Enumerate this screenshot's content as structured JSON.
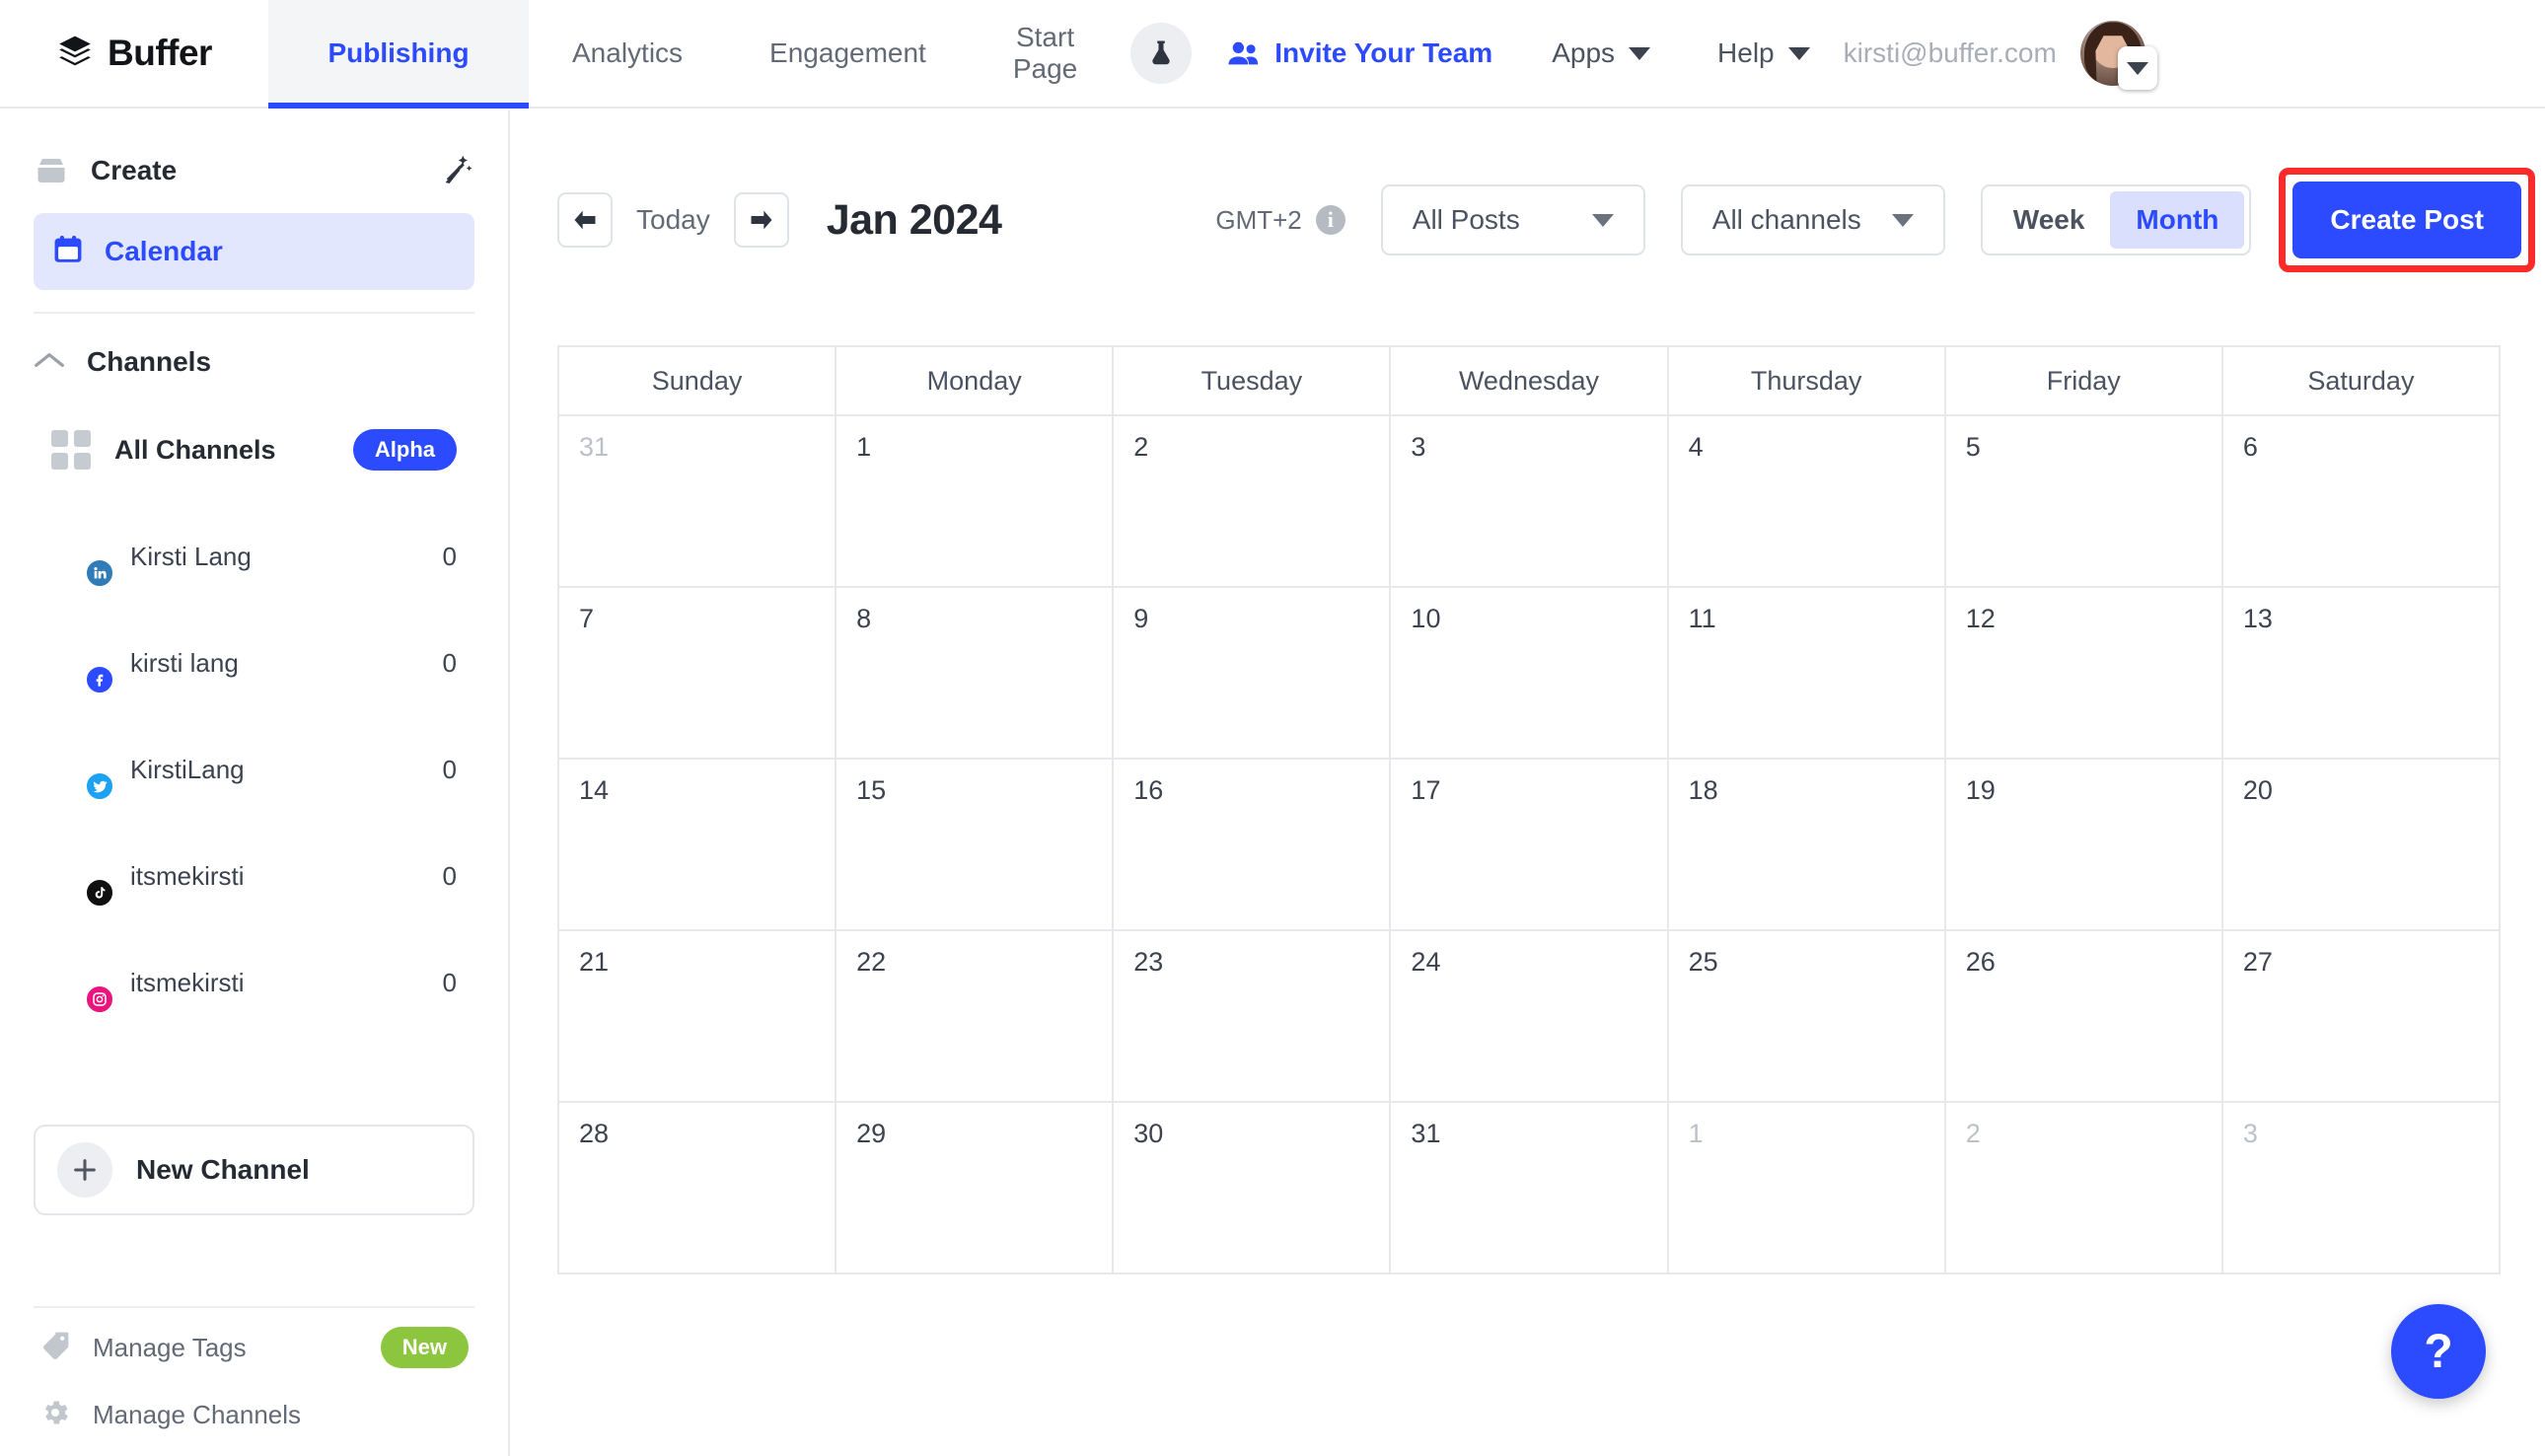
{
  "brand": {
    "name": "Buffer",
    "logo_icon": "buffer-layers-icon"
  },
  "topnav": {
    "tabs": [
      {
        "label": "Publishing",
        "active": true
      },
      {
        "label": "Analytics",
        "active": false
      },
      {
        "label": "Engagement",
        "active": false
      },
      {
        "label": "Start\nPage",
        "active": false
      }
    ],
    "lab_icon": "flask-icon",
    "invite": {
      "label": "Invite Your Team",
      "icon": "people-icon"
    },
    "apps": {
      "label": "Apps",
      "icon": "chevron-down-icon"
    },
    "help": {
      "label": "Help",
      "icon": "chevron-down-icon"
    },
    "user_email": "kirsti@buffer.com",
    "avatar_icon": "user-avatar",
    "avatar_caret_icon": "chevron-down-icon"
  },
  "sidebar": {
    "create": {
      "label": "Create",
      "icon": "stack-icon",
      "magic_icon": "magic-wand-icon"
    },
    "calendar": {
      "label": "Calendar",
      "icon": "calendar-icon",
      "active": true
    },
    "channels_section": {
      "label": "Channels",
      "icon": "chevron-up-icon"
    },
    "all_channels": {
      "label": "All Channels",
      "badge": "Alpha",
      "icon": "grid-icon"
    },
    "channels": [
      {
        "name": "Kirsti Lang",
        "count": "0",
        "network": "linkedin"
      },
      {
        "name": "kirsti lang",
        "count": "0",
        "network": "facebook"
      },
      {
        "name": "KirstiLang",
        "count": "0",
        "network": "twitter"
      },
      {
        "name": "itsmekirsti",
        "count": "0",
        "network": "tiktok"
      },
      {
        "name": "itsmekirsti",
        "count": "0",
        "network": "instagram"
      }
    ],
    "new_channel": {
      "label": "New Channel",
      "icon": "plus-icon"
    },
    "bottom": [
      {
        "label": "Manage Tags",
        "icon": "tag-icon",
        "badge": "New"
      },
      {
        "label": "Manage Channels",
        "icon": "gear-icon",
        "badge": ""
      }
    ]
  },
  "toolbar": {
    "prev_icon": "arrow-left-icon",
    "today_label": "Today",
    "next_icon": "arrow-right-icon",
    "month_title": "Jan 2024",
    "timezone": "GMT+2",
    "timezone_info_icon": "info-icon",
    "post_filter": "All Posts",
    "channel_filter": "All channels",
    "view_week": "Week",
    "view_month": "Month",
    "view_selected": "Month",
    "create_post": "Create Post",
    "highlight_color": "#fc2b29"
  },
  "calendar": {
    "weekdays": [
      "Sunday",
      "Monday",
      "Tuesday",
      "Wednesday",
      "Thursday",
      "Friday",
      "Saturday"
    ],
    "weeks": [
      [
        {
          "d": "31",
          "o": true
        },
        {
          "d": "1"
        },
        {
          "d": "2"
        },
        {
          "d": "3"
        },
        {
          "d": "4"
        },
        {
          "d": "5"
        },
        {
          "d": "6"
        }
      ],
      [
        {
          "d": "7"
        },
        {
          "d": "8"
        },
        {
          "d": "9"
        },
        {
          "d": "10"
        },
        {
          "d": "11"
        },
        {
          "d": "12"
        },
        {
          "d": "13"
        }
      ],
      [
        {
          "d": "14"
        },
        {
          "d": "15"
        },
        {
          "d": "16"
        },
        {
          "d": "17"
        },
        {
          "d": "18"
        },
        {
          "d": "19"
        },
        {
          "d": "20"
        }
      ],
      [
        {
          "d": "21"
        },
        {
          "d": "22"
        },
        {
          "d": "23"
        },
        {
          "d": "24"
        },
        {
          "d": "25"
        },
        {
          "d": "26"
        },
        {
          "d": "27"
        }
      ],
      [
        {
          "d": "28"
        },
        {
          "d": "29"
        },
        {
          "d": "30"
        },
        {
          "d": "31"
        },
        {
          "d": "1",
          "o": true
        },
        {
          "d": "2",
          "o": true
        },
        {
          "d": "3",
          "o": true
        }
      ]
    ]
  },
  "help_fab": {
    "label": "?"
  },
  "colors": {
    "accent": "#2c4bff",
    "accent_soft": "#e3e7fe",
    "highlight": "#fc2b29",
    "new_badge": "#8cc63e"
  }
}
